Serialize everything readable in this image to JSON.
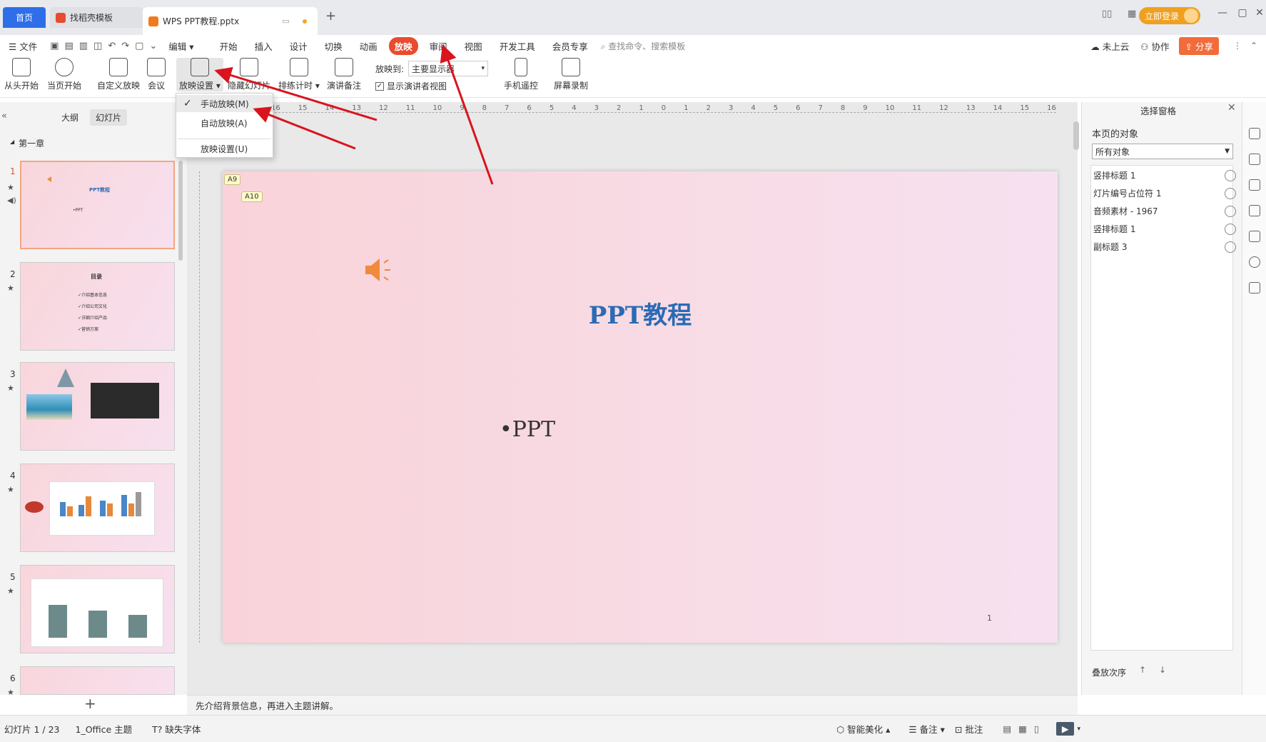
{
  "titlebar": {
    "tabs": [
      {
        "label": "首页"
      },
      {
        "label": "找稻壳模板"
      },
      {
        "label": "WPS PPT教程.pptx"
      }
    ],
    "login": "立即登录"
  },
  "menu": {
    "file": "文件",
    "edit": "编辑",
    "items": [
      "开始",
      "插入",
      "设计",
      "切换",
      "动画",
      "放映",
      "审阅",
      "视图",
      "开发工具",
      "会员专享"
    ],
    "active": "放映",
    "search_placeholder": "查找命令、搜索模板",
    "cloud": "未上云",
    "collab": "协作",
    "share": "分享"
  },
  "ribbon": {
    "from_start": "从头开始",
    "from_current": "当页开始",
    "custom_show": "自定义放映",
    "meeting": "会议",
    "show_settings": "放映设置",
    "hide_slide": "隐藏幻灯片",
    "rehearse": "排练计时",
    "speaker_notes": "演讲备注",
    "show_to_label": "放映到:",
    "show_to_value": "主要显示器",
    "presenter_view": "显示演讲者视图",
    "phone_remote": "手机遥控",
    "screen_record": "屏幕录制"
  },
  "dropdown": {
    "items": [
      "手动放映(M)",
      "自动放映(A)",
      "放映设置(U)"
    ],
    "checked": "手动放映(M)"
  },
  "leftpane": {
    "tab_outline": "大纲",
    "tab_slides": "幻灯片",
    "section": "第一章",
    "slide_numbers": [
      "1",
      "2",
      "3",
      "4",
      "5",
      "6"
    ],
    "thumb2_title": "目录",
    "thumb2_items": [
      "✓介绍基本信息",
      "✓介绍公司文化",
      "✓详细介绍产品",
      "✓营销方案"
    ]
  },
  "ruler": {
    "h_ticks": [
      "16",
      "15",
      "14",
      "13",
      "12",
      "11",
      "10",
      "9",
      "8",
      "7",
      "6",
      "5",
      "4",
      "3",
      "2",
      "1",
      "0",
      "1",
      "2",
      "3",
      "4",
      "5",
      "6",
      "7",
      "8",
      "9",
      "10",
      "11",
      "12",
      "13",
      "14",
      "15",
      "16"
    ]
  },
  "slide": {
    "tag1": "A9",
    "tag2": "A10",
    "title": "PPT教程",
    "bullet": "•PPT",
    "page_number": "1"
  },
  "notes": "先介绍背景信息，再进入主题讲解。",
  "rightpane": {
    "title": "选择窗格",
    "subtitle": "本页的对象",
    "filter": "所有对象",
    "objects": [
      "竖排标题 1",
      "灯片编号占位符 1",
      "音频素材 - 1967",
      "竖排标题 1",
      "副标题 3"
    ],
    "order_label": "叠放次序"
  },
  "statusbar": {
    "slide_info": "幻灯片 1 / 23",
    "theme": "1_Office 主题",
    "missing_font": "缺失字体",
    "beautify": "智能美化",
    "notes": "备注",
    "comments": "批注"
  },
  "colors": {
    "accent_red": "#e84b2e",
    "title_blue": "#2a6bb5",
    "arrow_red": "#d9141e"
  }
}
